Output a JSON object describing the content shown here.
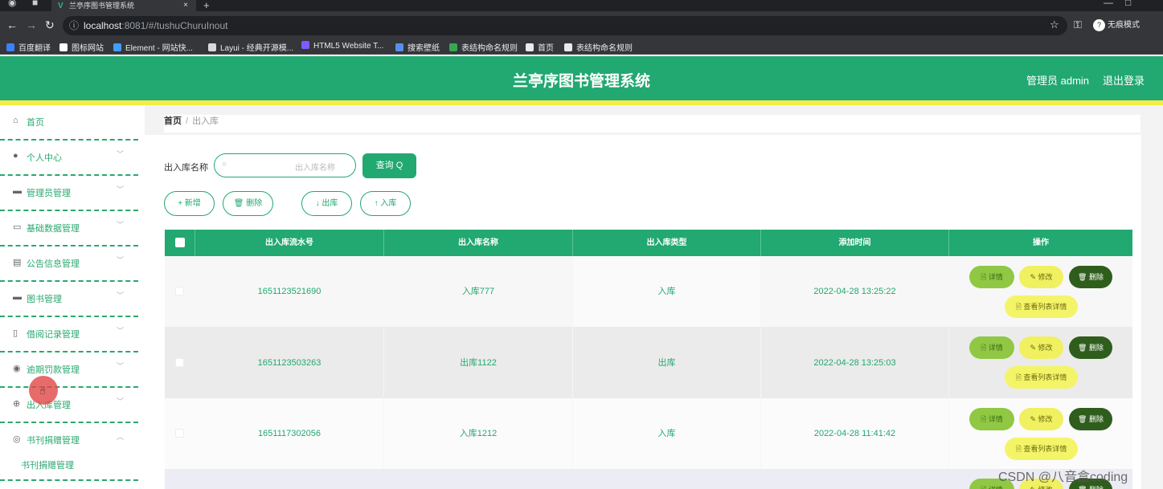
{
  "browser": {
    "tab_title": "兰亭序图书管理系统",
    "tab_close": "×",
    "new_tab": "+",
    "url_host": "localhost",
    "url_path": ":8081/#/tushuChuruInout",
    "profile_initial": "?",
    "profile_label": "无痕模式",
    "bookmarks": [
      {
        "label": "百度翻译",
        "color": "#3b82f6"
      },
      {
        "label": "图标网站",
        "color": "#ffffff"
      },
      {
        "label": "Element - 网站快...",
        "color": "#409eff"
      },
      {
        "label": "Layui - 经典开源模...",
        "color": "#d9d9d9"
      },
      {
        "label": "HTML5 Website T...",
        "color": "#7c5cff"
      },
      {
        "label": "搜索壁纸",
        "color": "#5b8def"
      },
      {
        "label": "表结构命名规则",
        "color": "#34a853"
      },
      {
        "label": "首页",
        "color": "#e8eaed"
      },
      {
        "label": "表结构命名规则",
        "color": "#e8eaed"
      }
    ]
  },
  "header": {
    "title": "兰亭序图书管理系统",
    "user": "管理员 admin",
    "logout": "退出登录"
  },
  "sidebar": {
    "items": [
      {
        "label": "首页",
        "icon": "home-icon",
        "glyph": "⌂"
      },
      {
        "label": "个人中心",
        "icon": "user-icon",
        "glyph": "●"
      },
      {
        "label": "管理员管理",
        "icon": "monitor-icon",
        "glyph": "▬"
      },
      {
        "label": "基础数据管理",
        "icon": "chat-icon",
        "glyph": "▭"
      },
      {
        "label": "公告信息管理",
        "icon": "document-icon",
        "glyph": "▤"
      },
      {
        "label": "图书管理",
        "icon": "message-icon",
        "glyph": "▬"
      },
      {
        "label": "借阅记录管理",
        "icon": "phone-icon",
        "glyph": "▯"
      },
      {
        "label": "逾期罚款管理",
        "icon": "location-icon",
        "glyph": "◉"
      },
      {
        "label": "出入库管理",
        "icon": "compass-icon",
        "glyph": "⊕"
      },
      {
        "label": "书刊捐赠管理",
        "icon": "gauge-icon",
        "glyph": "◎"
      }
    ],
    "sub_item": "书刊捐赠管理",
    "chevron_down": "﹀",
    "chevron_up": "︿"
  },
  "breadcrumb": {
    "home": "首页",
    "separator": "/",
    "current": "出入库"
  },
  "search": {
    "label": "出入库名称",
    "placeholder": "出入库名称",
    "button": "查询 Q"
  },
  "actions": {
    "add": "+ 新增",
    "delete": "🗑 删除",
    "out": "↓ 出库",
    "in": "↑ 入库"
  },
  "table": {
    "columns": [
      "出入库流水号",
      "出入库名称",
      "出入库类型",
      "添加时间",
      "操作"
    ],
    "rows": [
      {
        "serial": "1651123521690",
        "name": "入库777",
        "type": "入库",
        "time": "2022-04-28 13:25:22"
      },
      {
        "serial": "1651123503263",
        "name": "出库1122",
        "type": "出库",
        "time": "2022-04-28 13:25:03"
      },
      {
        "serial": "1651117302056",
        "name": "入库1212",
        "type": "入库",
        "time": "2022-04-28 11:41:42"
      },
      {
        "serial": "",
        "name": "",
        "type": "",
        "time": ""
      }
    ],
    "row_buttons": {
      "detail": "🗎 详情",
      "edit": "✎ 修改",
      "delete": "🗑 删除",
      "list_detail": "🗎 查看列表详情"
    }
  },
  "watermark": "CSDN @八音盒coding",
  "colors": {
    "primary": "#22a871",
    "accent_yellow": "#f2ec4a",
    "detail_btn": "#90c844",
    "edit_btn": "#f0f060",
    "delete_btn": "#2f5e1c"
  }
}
